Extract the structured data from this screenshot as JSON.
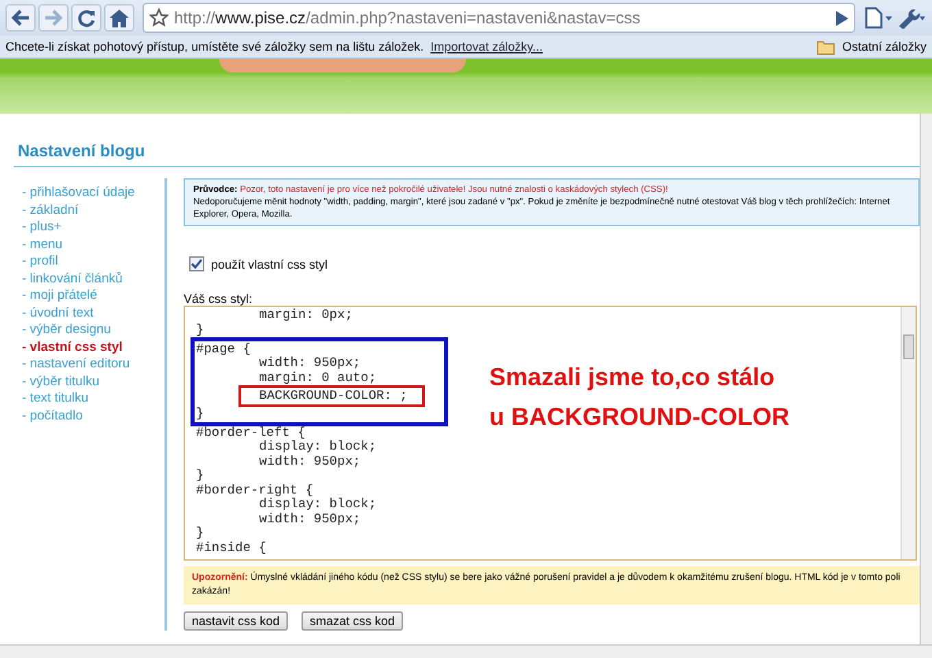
{
  "browser": {
    "url": "http://**www.pise.cz**/admin.php?nastaveni=nastaveni&nastav=css",
    "bookmarks_bar": {
      "message": "Chcete-li získat pohotový přístup, umístěte své záložky sem na lištu záložek.",
      "link": "Importovat záložky...",
      "other": "Ostatní záložky"
    }
  },
  "page": {
    "heading": "Nastavení blogu",
    "sidebar": [
      {
        "label": "- přihlašovací údaje",
        "selected": false
      },
      {
        "label": "- základní",
        "selected": false
      },
      {
        "label": "- plus+",
        "selected": false
      },
      {
        "label": "- menu",
        "selected": false
      },
      {
        "label": "- profil",
        "selected": false
      },
      {
        "label": "- linkování článků",
        "selected": false
      },
      {
        "label": "- moji přátelé",
        "selected": false
      },
      {
        "label": "- úvodní text",
        "selected": false
      },
      {
        "label": "- výběr designu",
        "selected": false
      },
      {
        "label": "- vlastní css styl",
        "selected": true
      },
      {
        "label": "- nastavení editoru",
        "selected": false
      },
      {
        "label": "- výběr titulku",
        "selected": false
      },
      {
        "label": "- text titulku",
        "selected": false
      },
      {
        "label": "- počítadlo",
        "selected": false
      }
    ],
    "guide": {
      "title": "Průvodce:",
      "warning": "Pozor, toto nastavení je pro více než pokročilé uživatele! Jsou nutné znalosti o kaskádových stylech (CSS)!",
      "text": "Nedoporučujeme měnit hodnoty \"width, padding, margin\", které jsou zadané v \"px\". Pokud je změníte je bezpodmínečně nutné otestovat Váš blog v těch prohlížečích: Internet Explorer, Opera, Mozilla."
    },
    "use_custom_css": {
      "label": "použít vlastní css styl",
      "checked": true
    },
    "css_label": "Váš css styl:",
    "css_rules": [
      {
        "declarations": [
          {
            "text": "margin: 0px;",
            "highlighted": false
          }
        ],
        "close": "}",
        "highlighted": false
      },
      {
        "selector": "#page {",
        "declarations": [
          {
            "text": "width: 950px;",
            "highlighted": false
          },
          {
            "text": "margin: 0 auto;",
            "highlighted": false
          },
          {
            "text": "BACKGROUND-COLOR: ;",
            "highlighted": true
          }
        ],
        "close": "}",
        "highlighted": true
      },
      {
        "selector": "#border-left {",
        "declarations": [
          {
            "text": "display: block;",
            "highlighted": false
          },
          {
            "text": "width: 950px;",
            "highlighted": false
          }
        ],
        "close": "}",
        "highlighted": false
      },
      {
        "selector": "#border-right {",
        "declarations": [
          {
            "text": "display: block;",
            "highlighted": false
          },
          {
            "text": "width: 950px;",
            "highlighted": false
          }
        ],
        "close": "}",
        "highlighted": false
      },
      {
        "selector": "#inside {",
        "highlighted": false
      }
    ],
    "notice": {
      "title": "Upozornění:",
      "text": "Úmyslné vkládání jiného kódu (než CSS stylu) se bere jako vážné porušení pravidel a je důvodem k okamžitému zrušení blogu. HTML kód je v tomto poli zakázán!"
    },
    "buttons": [
      "nastavit css kod",
      "smazat css kod"
    ]
  },
  "annotation": {
    "lines": [
      "Smazali jsme to,co stálo",
      "u BACKGROUND-COLOR"
    ]
  }
}
